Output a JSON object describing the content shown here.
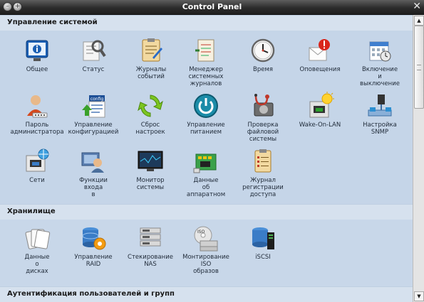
{
  "window": {
    "title": "Control Panel",
    "close_glyph": "✕"
  },
  "sections": {
    "system": {
      "title": "Управление системой",
      "items": [
        {
          "label": "Общее",
          "icon": "general-icon"
        },
        {
          "label": "Статус",
          "icon": "status-icon"
        },
        {
          "label": "Журналы\nсобытий",
          "icon": "event-logs-icon"
        },
        {
          "label": "Менеджер\nсистемных\nжурналов",
          "icon": "syslog-manager-icon"
        },
        {
          "label": "Время",
          "icon": "clock-icon"
        },
        {
          "label": "Оповещения",
          "icon": "notifications-icon"
        },
        {
          "label": "Включение\nи\nвыключение",
          "icon": "power-schedule-icon"
        },
        {
          "label": "Пароль\nадминистратора",
          "icon": "admin-password-icon"
        },
        {
          "label": "Управление\nконфигурацией",
          "icon": "config-management-icon"
        },
        {
          "label": "Сброс\nнастроек",
          "icon": "reset-settings-icon"
        },
        {
          "label": "Управление\nпитанием",
          "icon": "power-management-icon"
        },
        {
          "label": "Проверка\nфайловой\nсистемы",
          "icon": "filesystem-check-icon"
        },
        {
          "label": "Wake-On-LAN",
          "icon": "wake-on-lan-icon"
        },
        {
          "label": "Настройка\nSNMP",
          "icon": "snmp-icon"
        },
        {
          "label": "Сети",
          "icon": "network-icon"
        },
        {
          "label": "Функции\nвхода\nв",
          "icon": "login-functions-icon"
        },
        {
          "label": "Монитор\nсистемы",
          "icon": "system-monitor-icon"
        },
        {
          "label": "Данные\nоб\nаппаратном",
          "icon": "hardware-info-icon"
        },
        {
          "label": "Журнал\nрегистрации\nдоступа",
          "icon": "access-log-icon"
        }
      ]
    },
    "storage": {
      "title": "Хранилище",
      "items": [
        {
          "label": "Данные\nо\nдисках",
          "icon": "disk-info-icon"
        },
        {
          "label": "Управление\nRAID",
          "icon": "raid-icon"
        },
        {
          "label": "Стекирование\nNAS",
          "icon": "nas-stacking-icon"
        },
        {
          "label": "Монтирование\nISO\nобразов",
          "icon": "iso-mount-icon"
        },
        {
          "label": "iSCSI",
          "icon": "iscsi-icon"
        }
      ]
    },
    "auth": {
      "title": "Аутентификация пользователей и групп"
    }
  },
  "config_icon_text": "config",
  "iso_icon_text": "ISO"
}
